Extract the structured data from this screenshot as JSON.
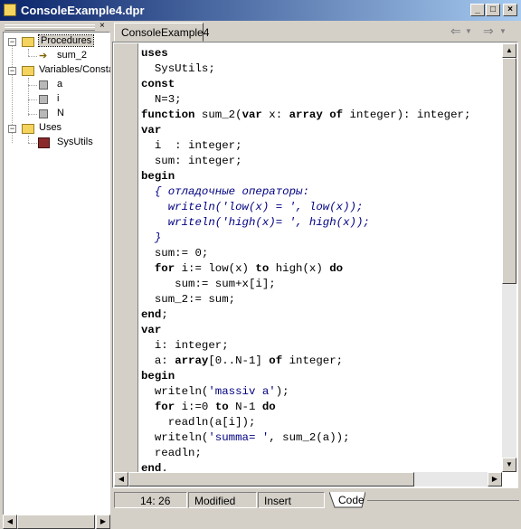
{
  "window": {
    "title": "ConsoleExample4.dpr",
    "controls": [
      "_",
      "□",
      "×"
    ]
  },
  "left_pane": {
    "close": "×",
    "tree": [
      {
        "label": "Procedures",
        "kind": "folder",
        "expander": "−",
        "selected": true
      },
      {
        "label": "sum_2",
        "kind": "procedure"
      },
      {
        "label": "Variables/Constants",
        "kind": "folder",
        "expander": "−"
      },
      {
        "label": "a",
        "kind": "variable"
      },
      {
        "label": "i",
        "kind": "variable"
      },
      {
        "label": "N",
        "kind": "variable"
      },
      {
        "label": "Uses",
        "kind": "folder",
        "expander": "−"
      },
      {
        "label": "SysUtils",
        "kind": "unit"
      }
    ]
  },
  "editor": {
    "tab": "ConsoleExample4",
    "nav": {
      "back": "⇐",
      "forward": "⇒"
    },
    "code": [
      "uses",
      "  SysUtils;",
      "const",
      "  N=3;",
      "function sum_2(var x: array of integer): integer;",
      "var",
      "  i  : integer;",
      "  sum: integer;",
      "begin",
      "  { отладочные операторы:",
      "    writeln('low(x) = ', low(x));",
      "    writeln('high(x)= ', high(x));",
      "  }",
      "  sum:= 0;",
      "  for i:= low(x) to high(x) do",
      "     sum:= sum+x[i];",
      "  sum_2:= sum;",
      "end;",
      "var",
      "  i: integer;",
      "  a: array[0..N-1] of integer;",
      "begin",
      "  writeln('massiv a');",
      "  for i:=0 to N-1 do",
      "    readln(a[i]);",
      "  writeln('summa= ', sum_2(a));",
      "  readln;",
      "end."
    ]
  },
  "status": {
    "position": "14: 26",
    "modified": "Modified",
    "mode": "Insert",
    "view_tab": "Code"
  }
}
